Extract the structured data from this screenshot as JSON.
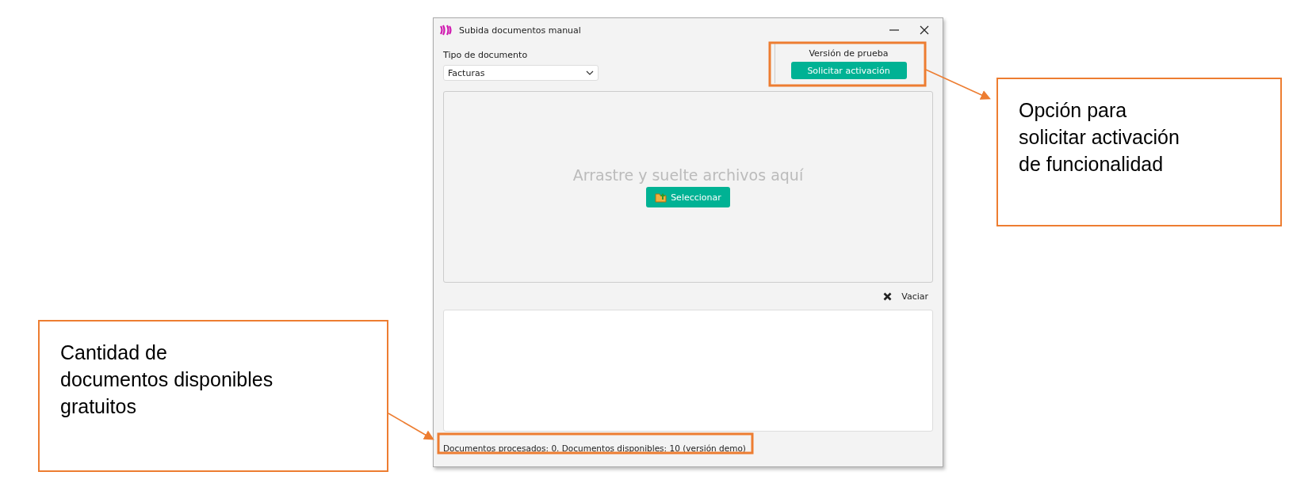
{
  "window": {
    "title": "Subida documentos manual",
    "document_type": {
      "label": "Tipo de documento",
      "value": "Facturas"
    },
    "trial_panel": {
      "label": "Versión de prueba",
      "button": "Solicitar activación"
    },
    "drop_zone": {
      "placeholder": "Arrastre y suelte archivos aquí",
      "button": "Seleccionar"
    },
    "clear_button": "Vaciar",
    "status_bar": "Documentos procesados: 0.  Documentos disponibles: 10  (versión demo)"
  },
  "callouts": [
    {
      "lines": [
        "Opción para",
        "solicitar activación",
        "de funcionalidad"
      ]
    },
    {
      "lines": [
        "Cantidad de",
        "documentos disponibles",
        "gratuitos"
      ]
    }
  ]
}
